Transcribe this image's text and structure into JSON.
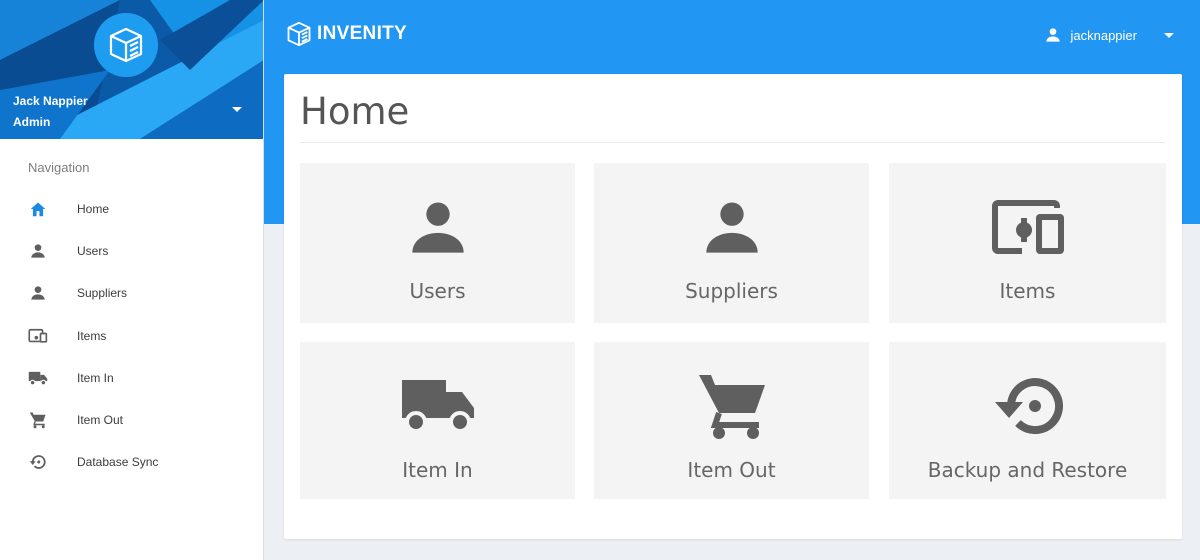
{
  "profile": {
    "name": "Jack Nappier",
    "role": "Admin"
  },
  "nav": {
    "title": "Navigation",
    "items": [
      {
        "label": "Home",
        "icon": "home-icon",
        "active": true
      },
      {
        "label": "Users",
        "icon": "person-icon"
      },
      {
        "label": "Suppliers",
        "icon": "person-icon"
      },
      {
        "label": "Items",
        "icon": "devices-icon"
      },
      {
        "label": "Item In",
        "icon": "truck-icon"
      },
      {
        "label": "Item Out",
        "icon": "cart-icon"
      },
      {
        "label": "Database Sync",
        "icon": "restore-icon"
      }
    ]
  },
  "header": {
    "brand": "INVENITY",
    "username": "jacknappier"
  },
  "main": {
    "title": "Home",
    "tiles": [
      {
        "label": "Users",
        "icon": "person-icon"
      },
      {
        "label": "Suppliers",
        "icon": "person-icon"
      },
      {
        "label": "Items",
        "icon": "devices-icon"
      },
      {
        "label": "Item In",
        "icon": "truck-icon"
      },
      {
        "label": "Item Out",
        "icon": "cart-icon"
      },
      {
        "label": "Backup and Restore",
        "icon": "restore-icon"
      }
    ]
  },
  "colors": {
    "primary": "#2196f3",
    "active_icon": "#1e88e5",
    "icon_gray": "#5f5f5f",
    "tile_bg": "#f4f4f4"
  }
}
